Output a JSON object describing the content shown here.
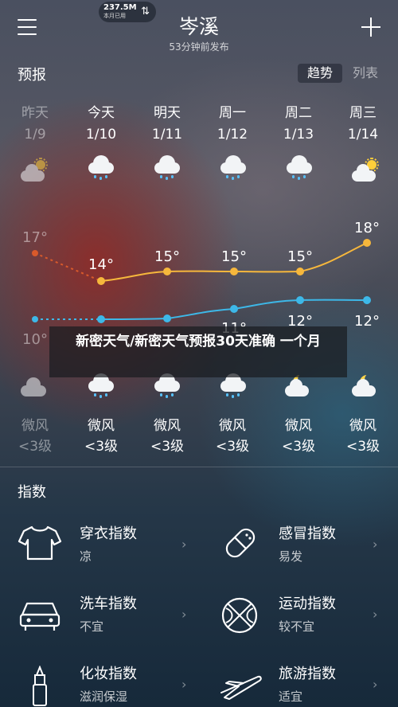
{
  "status": {
    "speed": "237.5M",
    "sub": "本月已用",
    "arrows": "⇅"
  },
  "header": {
    "city": "岑溪",
    "updated": "53分钟前发布"
  },
  "forecast": {
    "title": "预报",
    "toggle": {
      "active": "趋势",
      "inactive": "列表"
    },
    "days": [
      {
        "name": "昨天",
        "date": "1/9",
        "icon": "cloud-sun-icon",
        "high": "17°",
        "low": "10°",
        "night_icon": "cloud-night-icon",
        "wind": "微风",
        "level": "<3级"
      },
      {
        "name": "今天",
        "date": "1/10",
        "icon": "cloud-rain-icon",
        "high": "14°",
        "low": "",
        "night_icon": "cloud-rain-icon",
        "wind": "微风",
        "level": "<3级"
      },
      {
        "name": "明天",
        "date": "1/11",
        "icon": "cloud-rain-icon",
        "high": "15°",
        "low": "",
        "night_icon": "cloud-rain-icon",
        "wind": "微风",
        "level": "<3级"
      },
      {
        "name": "周一",
        "date": "1/12",
        "icon": "cloud-rain-icon",
        "high": "15°",
        "low": "11°",
        "night_icon": "cloud-rain-icon",
        "wind": "微风",
        "level": "<3级"
      },
      {
        "name": "周二",
        "date": "1/13",
        "icon": "cloud-rain-icon",
        "high": "15°",
        "low": "12°",
        "night_icon": "moon-cloud-icon",
        "wind": "微风",
        "level": "<3级"
      },
      {
        "name": "周三",
        "date": "1/14",
        "icon": "cloud-sun-icon",
        "high": "18°",
        "low": "12°",
        "night_icon": "moon-cloud-icon",
        "wind": "微风",
        "level": "<3级"
      }
    ],
    "colors": {
      "high": "#f6b73c",
      "low": "#3db8e8",
      "past_high": "#d95a2b"
    }
  },
  "overlay": {
    "text": "新密天气/新密天气预报30天准确 一个月"
  },
  "indices": {
    "title": "指数",
    "items": [
      {
        "title": "穿衣指数",
        "value": "凉",
        "icon": "tshirt-icon"
      },
      {
        "title": "感冒指数",
        "value": "易发",
        "icon": "pill-icon"
      },
      {
        "title": "洗车指数",
        "value": "不宜",
        "icon": "car-icon"
      },
      {
        "title": "运动指数",
        "value": "较不宜",
        "icon": "basketball-icon"
      },
      {
        "title": "化妆指数",
        "value": "滋润保湿",
        "icon": "lipstick-icon"
      },
      {
        "title": "旅游指数",
        "value": "适宜",
        "icon": "airplane-icon"
      }
    ],
    "chevron": "›"
  }
}
